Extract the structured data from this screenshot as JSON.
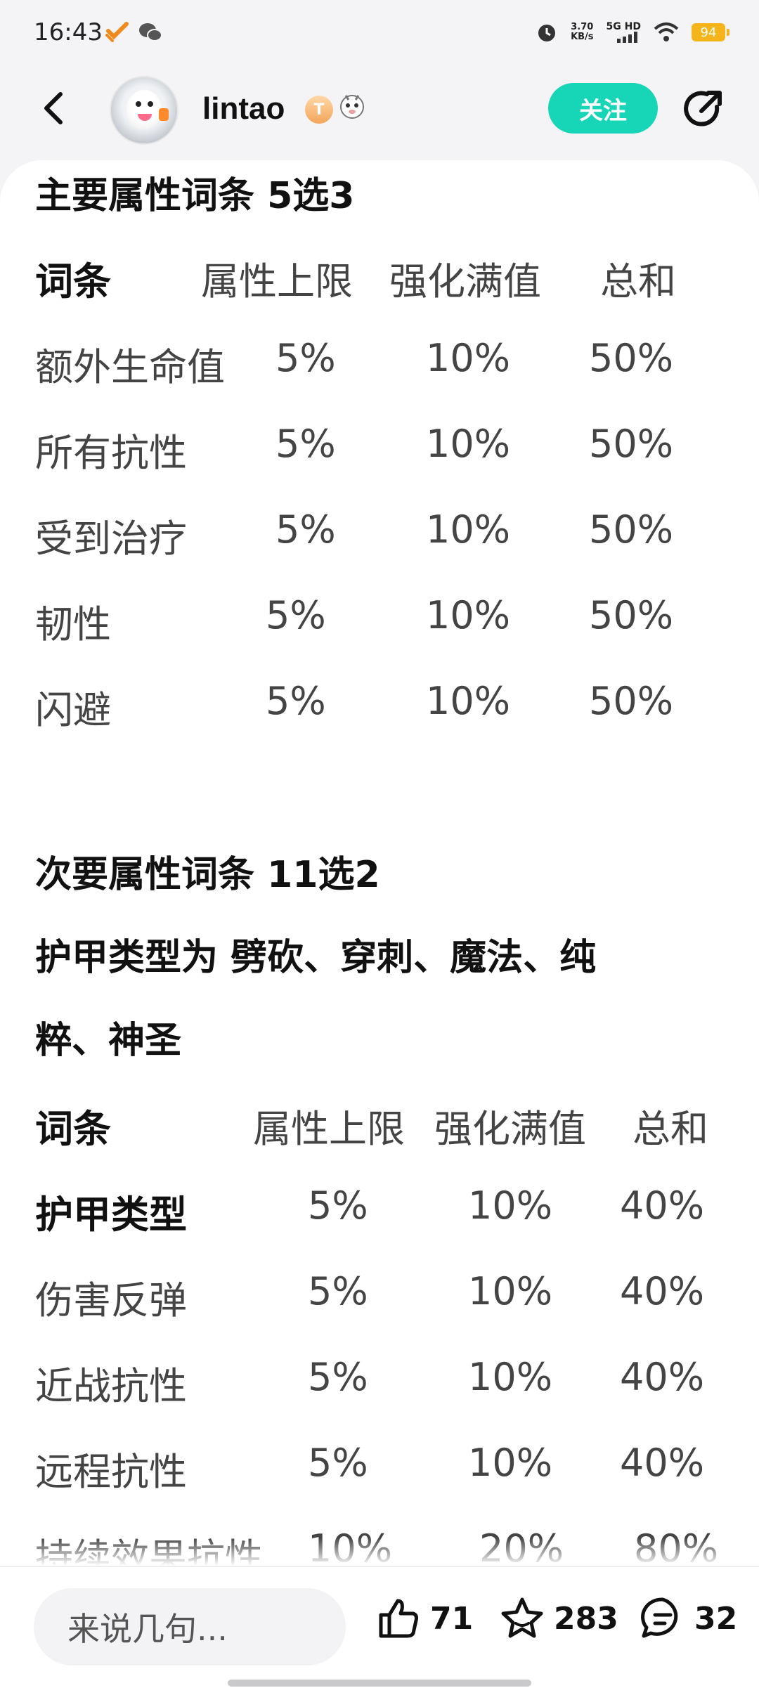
{
  "status_bar": {
    "time": "16:43",
    "net_speed_value": "3.70",
    "net_speed_unit": "KB/s",
    "network": "5G HD",
    "battery": "94"
  },
  "header": {
    "username": "lintao",
    "level_badge": "T",
    "follow_label": "关注"
  },
  "main_section": {
    "title": "主要属性词条  5选3",
    "headers": [
      "词条",
      "属性上限",
      "强化满值",
      "总和"
    ],
    "rows": [
      {
        "name": "额外生命值",
        "cap": "5%",
        "max": "10%",
        "total": "50%"
      },
      {
        "name": "所有抗性",
        "cap": "5%",
        "max": "10%",
        "total": "50%"
      },
      {
        "name": "受到治疗",
        "cap": "5%",
        "max": "10%",
        "total": "50%"
      },
      {
        "name": "韧性",
        "cap": "5%",
        "max": "10%",
        "total": "50%"
      },
      {
        "name": "闪避",
        "cap": "5%",
        "max": "10%",
        "total": "50%"
      }
    ]
  },
  "secondary_section": {
    "title": "次要属性词条  11选2",
    "note_line1": "护甲类型为 劈砍、穿刺、魔法、纯",
    "note_line2": "粹、神圣",
    "headers": [
      "词条",
      "属性上限",
      "强化满值",
      "总和"
    ],
    "rows": [
      {
        "name": "护甲类型",
        "cap": "5%",
        "max": "10%",
        "total": "40%"
      },
      {
        "name": "伤害反弹",
        "cap": "5%",
        "max": "10%",
        "total": "40%"
      },
      {
        "name": "近战抗性",
        "cap": "5%",
        "max": "10%",
        "total": "40%"
      },
      {
        "name": "远程抗性",
        "cap": "5%",
        "max": "10%",
        "total": "40%"
      },
      {
        "name": "持续效果抗性",
        "cap": "10%",
        "max": "20%",
        "total": "80%"
      }
    ]
  },
  "bottom_bar": {
    "comment_placeholder": "来说几句...",
    "likes": "71",
    "favorites": "283",
    "comments": "32"
  }
}
